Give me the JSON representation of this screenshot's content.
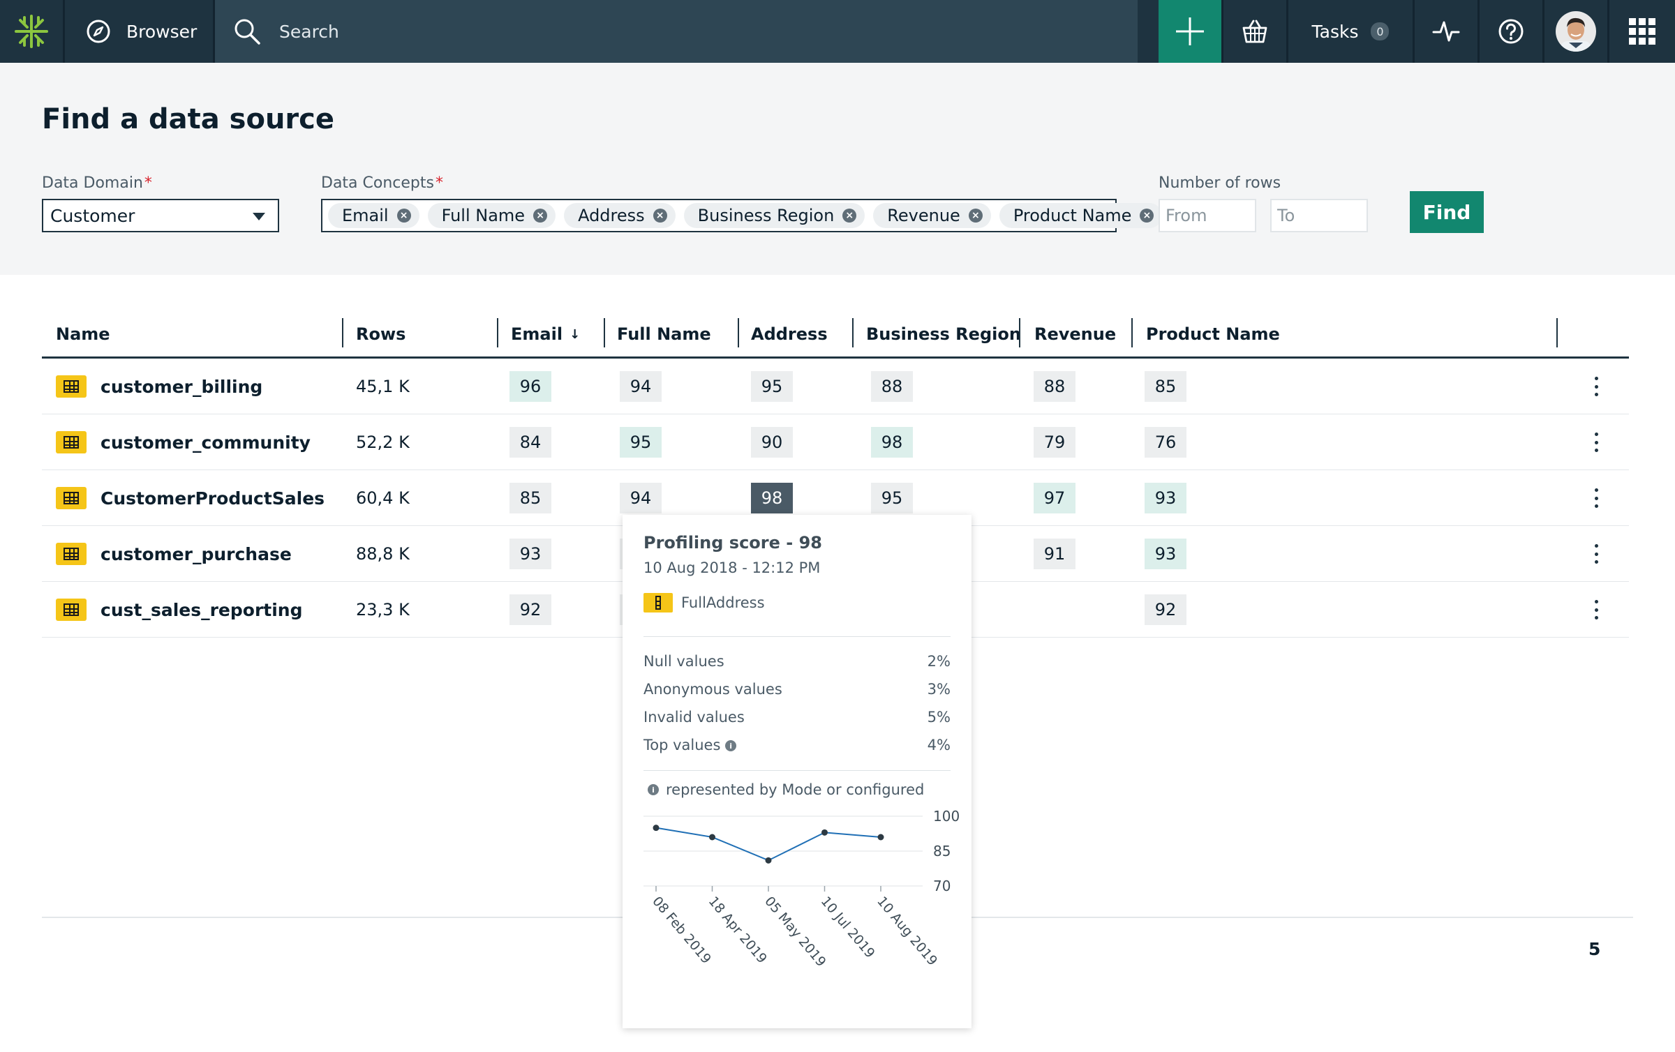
{
  "topbar": {
    "browser_label": "Browser",
    "search_placeholder": "Search",
    "tasks_label": "Tasks",
    "tasks_count": "0"
  },
  "filters": {
    "title": "Find a data source",
    "domain_label": "Data Domain",
    "domain_value": "Customer",
    "concepts_label": "Data Concepts",
    "required_mark": "*",
    "concepts": [
      "Email",
      "Full Name",
      "Address",
      "Business Region",
      "Revenue",
      "Product Name"
    ],
    "rows_label": "Number of rows",
    "from_placeholder": "From",
    "to_placeholder": "To",
    "find_label": "Find"
  },
  "table": {
    "columns": [
      "Name",
      "Rows",
      "Email",
      "Full Name",
      "Address",
      "Business Region",
      "Revenue",
      "Product Name"
    ],
    "sort_indicator": "↓",
    "rows": [
      {
        "name": "customer_billing",
        "rows": "45,1 K",
        "email": "96",
        "full_name": "94",
        "address": "95",
        "region": "88",
        "revenue": "88",
        "product": "85"
      },
      {
        "name": "customer_community",
        "rows": "52,2 K",
        "email": "84",
        "full_name": "95",
        "address": "90",
        "region": "98",
        "revenue": "79",
        "product": "76"
      },
      {
        "name": "CustomerProductSales",
        "rows": "60,4 K",
        "email": "85",
        "full_name": "94",
        "address": "98",
        "region": "95",
        "revenue": "97",
        "product": "93"
      },
      {
        "name": "customer_purchase",
        "rows": "88,8 K",
        "email": "93",
        "full_name": "",
        "address": "",
        "region": "",
        "revenue": "91",
        "product": "93"
      },
      {
        "name": "cust_sales_reporting",
        "rows": "23,3 K",
        "email": "92",
        "full_name": "",
        "address": "",
        "region": "",
        "revenue": "",
        "product": "92"
      }
    ]
  },
  "pagination": {
    "total": "5"
  },
  "tooltip": {
    "title": "Profiling score - 98",
    "date": "10 Aug 2018 - 12:12 PM",
    "column": "FullAddress",
    "stats": [
      {
        "label": "Null values",
        "value": "2%"
      },
      {
        "label": "Anonymous values",
        "value": "3%"
      },
      {
        "label": "Invalid values",
        "value": "5%"
      },
      {
        "label": "Top values",
        "value": "4%"
      }
    ],
    "info_glyph": "i",
    "note": "represented by Mode or configured"
  },
  "chart_data": {
    "type": "line",
    "categories": [
      "08 Feb 2019",
      "18 Apr 2019",
      "05 May 2019",
      "10 Jul 2019",
      "10 Aug 2019"
    ],
    "values": [
      95,
      91,
      81,
      93,
      91
    ],
    "ylim": [
      70,
      100
    ],
    "yticks": [
      "100",
      "85",
      "70"
    ],
    "grid": true,
    "color": "#1f6fb5"
  },
  "colors": {
    "topbar": "#1e3340",
    "accent": "#12876f",
    "table_icon": "#f5c518",
    "score_highlight": "#dcefeb",
    "score_active": "#4a5a66"
  }
}
